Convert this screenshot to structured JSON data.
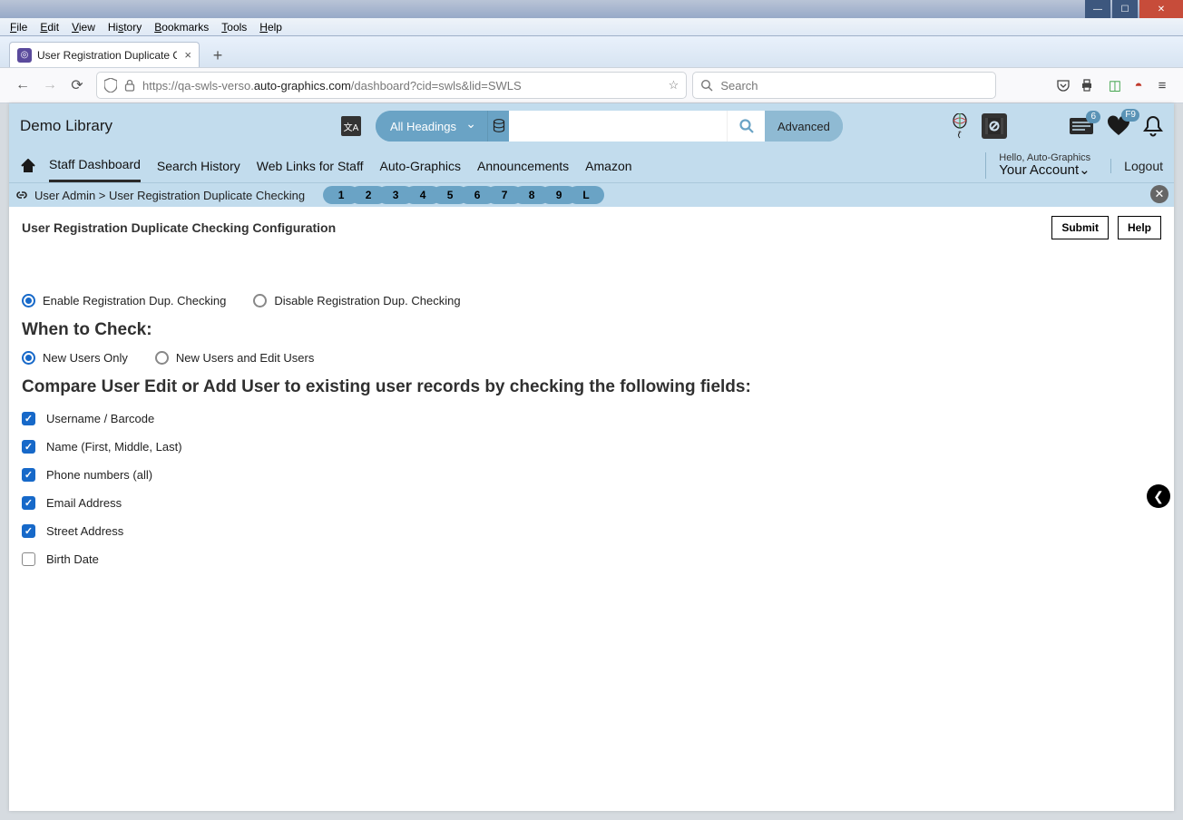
{
  "window": {
    "menus": [
      "File",
      "Edit",
      "View",
      "History",
      "Bookmarks",
      "Tools",
      "Help"
    ],
    "tab_title": "User Registration Duplicate Che",
    "url_prefix": "https://qa-swls-verso.",
    "url_domain": "auto-graphics.com",
    "url_path": "/dashboard?cid=swls&lid=SWLS",
    "search_placeholder": "Search"
  },
  "header": {
    "library_name": "Demo Library",
    "heading_label": "All Headings",
    "advanced": "Advanced",
    "card_badge": "6",
    "heart_badge": "F9"
  },
  "mainnav": {
    "items": [
      "Staff Dashboard",
      "Search History",
      "Web Links for Staff",
      "Auto-Graphics",
      "Announcements",
      "Amazon"
    ],
    "hello": "Hello, Auto-Graphics",
    "account": "Your Account⌄",
    "logout": "Logout"
  },
  "breadcrumb": {
    "path": "User Admin > User Registration Duplicate Checking",
    "pages": [
      "1",
      "2",
      "3",
      "4",
      "5",
      "6",
      "7",
      "8",
      "9",
      "L"
    ]
  },
  "page": {
    "title": "User Registration Duplicate Checking Configuration",
    "submit": "Submit",
    "help": "Help",
    "enable_label": "Enable Registration Dup. Checking",
    "disable_label": "Disable Registration Dup. Checking",
    "when_heading": "When to Check:",
    "when_new": "New Users Only",
    "when_both": "New Users and Edit Users",
    "compare_heading": "Compare User Edit or Add User to existing user records by checking the following fields:",
    "fields": [
      {
        "label": "Username / Barcode",
        "checked": true
      },
      {
        "label": "Name (First, Middle, Last)",
        "checked": true
      },
      {
        "label": "Phone numbers (all)",
        "checked": true
      },
      {
        "label": "Email Address",
        "checked": true
      },
      {
        "label": "Street Address",
        "checked": true
      },
      {
        "label": "Birth Date",
        "checked": false
      }
    ]
  }
}
